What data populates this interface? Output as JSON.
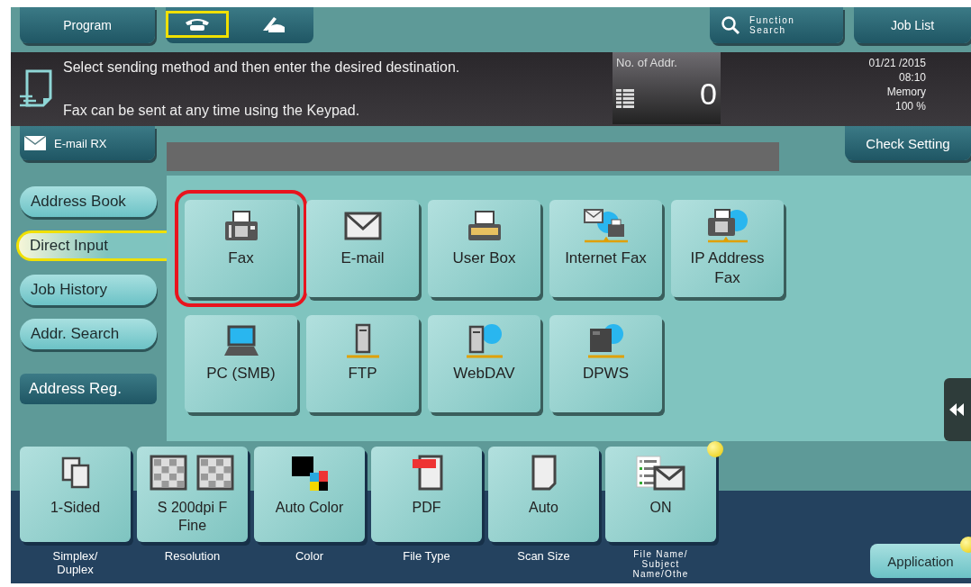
{
  "top_bar": {
    "program": "Program",
    "modes": [
      {
        "kind": "handset",
        "selected": true
      },
      {
        "kind": "hook",
        "selected": false
      }
    ],
    "function_search": [
      "Function",
      "Search"
    ],
    "job_list": "Job List"
  },
  "message": {
    "lines": [
      "Select sending method and then enter the desired destination.",
      "Fax can be sent at any time using the Keypad."
    ]
  },
  "address_count": {
    "label": "No. of Addr.",
    "value": "0"
  },
  "status": {
    "date": "01/21 /2015",
    "time": "08:10",
    "memory_label": "Memory",
    "memory": "100 %"
  },
  "email_rx": "E-mail RX",
  "check_setting": "Check Setting",
  "sidebar": {
    "items": [
      {
        "label": "Address Book",
        "selected": false
      },
      {
        "label": "Direct Input",
        "selected": true
      },
      {
        "label": "Job History",
        "selected": false
      },
      {
        "label": "Addr. Search",
        "selected": false
      }
    ],
    "address_reg": "Address Reg."
  },
  "destinations": [
    {
      "label": "Fax",
      "kind": "fax",
      "selected": true
    },
    {
      "label": "E-mail",
      "kind": "email",
      "selected": false
    },
    {
      "label": "User Box",
      "kind": "box",
      "selected": false
    },
    {
      "label": "Internet Fax",
      "kind": "ifax",
      "selected": false
    },
    {
      "label": "IP Address Fax",
      "kind": "ipfax",
      "selected": false
    },
    {
      "label": "PC (SMB)",
      "kind": "pc",
      "selected": false
    },
    {
      "label": "FTP",
      "kind": "ftp",
      "selected": false
    },
    {
      "label": "WebDAV",
      "kind": "webdav",
      "selected": false
    },
    {
      "label": "DPWS",
      "kind": "dpws",
      "selected": false
    }
  ],
  "settings": [
    {
      "value": "1-Sided",
      "caption": "Simplex/ Duplex",
      "kind": "sided",
      "notice": false
    },
    {
      "value": "S 200dpi F Fine",
      "caption": "Resolution",
      "kind": "resolution",
      "notice": false
    },
    {
      "value": "Auto Color",
      "caption": "Color",
      "kind": "color",
      "notice": false
    },
    {
      "value": "PDF",
      "caption": "File Type",
      "kind": "pdf",
      "notice": false
    },
    {
      "value": "Auto",
      "caption": "Scan Size",
      "kind": "size",
      "notice": false
    },
    {
      "value": "ON",
      "caption": "File Name/ Subject Name/Othe",
      "kind": "filename",
      "notice": true
    }
  ],
  "application": {
    "label": "Application",
    "notice": true
  }
}
